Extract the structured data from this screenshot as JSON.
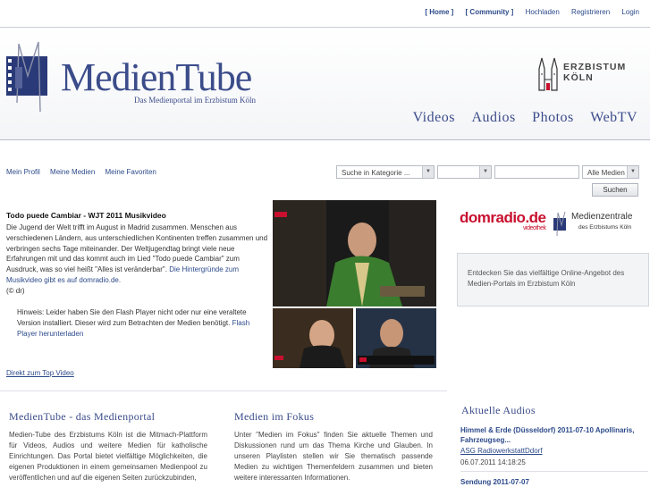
{
  "topnav": {
    "home": "[ Home ]",
    "community": "[ Community ]",
    "upload": "Hochladen",
    "register": "Registrieren",
    "login": "Login"
  },
  "header": {
    "title": "MedienTube",
    "subtitle": "Das Medienportal im Erzbistum Köln",
    "partner": "ERZBISTUM KÖLN",
    "nav": [
      "Videos",
      "Audios",
      "Photos",
      "WebTV"
    ]
  },
  "subnav": [
    "Mein Profil",
    "Meine Medien",
    "Meine Favoriten"
  ],
  "search": {
    "category_placeholder": "Suche in Kategorie ...",
    "scope": "Alle Medien",
    "button": "Suchen"
  },
  "feature": {
    "title": "Todo puede Cambiar - WJT 2011 Musikvideo",
    "text": "Die Jugend der Welt trifft im August in Madrid zusammen. Menschen aus verschiedenen Ländern, aus unterschiedlichen Kontinenten treffen zusammen und verbringen sechs Tage miteinander. Der Weltjugendtag bringt viele neue Erfahrungen mit und das kommt auch im Lied \"Todo puede Cambiar\" zum Ausdruck, was so viel heißt \"Alles ist veränderbar\".",
    "link": "Die Hintergründe zum Musikvideo gibt es auf domradio.de.",
    "copyright": "(© dr)",
    "flash_notice": "Hinweis: Leider haben Sie den Flash Player nicht oder nur eine veraltete Version installiert. Dieser wird zum Betrachten der Medien benötigt.",
    "flash_link": "Flash Player herunterladen",
    "top_video_link": "Direkt zum Top Video"
  },
  "sidebar": {
    "domradio": "domradio.de",
    "domradio_sub": "videothek",
    "medienzentrale": "Medienzentrale",
    "medienzentrale_sub": "des Erzbistums Köln",
    "info": "Entdecken Sie das vielfältige Online-Angebot des Medien-Portals im Erzbistum Köln"
  },
  "sections": {
    "portal": {
      "title": "MedienTube - das Medienportal",
      "text": "Medien-Tube des Erzbistums Köln ist die Mitmach-Plattform für Videos, Audios und weitere Medien für katholische Einrichtungen. Das Portal bietet vielfältige Möglichkeiten, die eigenen Produktionen in einem gemeinsamen Medienpool zu veröffentlichen und auf die eigenen Seiten zurückzubinden,"
    },
    "focus": {
      "title": "Medien im Fokus",
      "text": "Unter \"Medien im Fokus\" finden Sie aktuelle Themen und Diskussionen rund um das Thema Kirche und Glauben. In unseren Playlisten stellen wir Sie thematisch passende Medien zu wichtigen Themenfeldern zusammen und bieten weitere interessanten Informationen."
    },
    "audios": {
      "title": "Aktuelle Audios",
      "items": [
        {
          "title": "Himmel & Erde (Düsseldorf) 2011-07-10 Apollinaris, Fahrzeugseg...",
          "source": "ASG RadiowerkstattDdorf",
          "date": "06.07.2011 14:18:25"
        },
        {
          "title": "Sendung 2011-07-07",
          "source": "",
          "date": ""
        }
      ]
    }
  }
}
